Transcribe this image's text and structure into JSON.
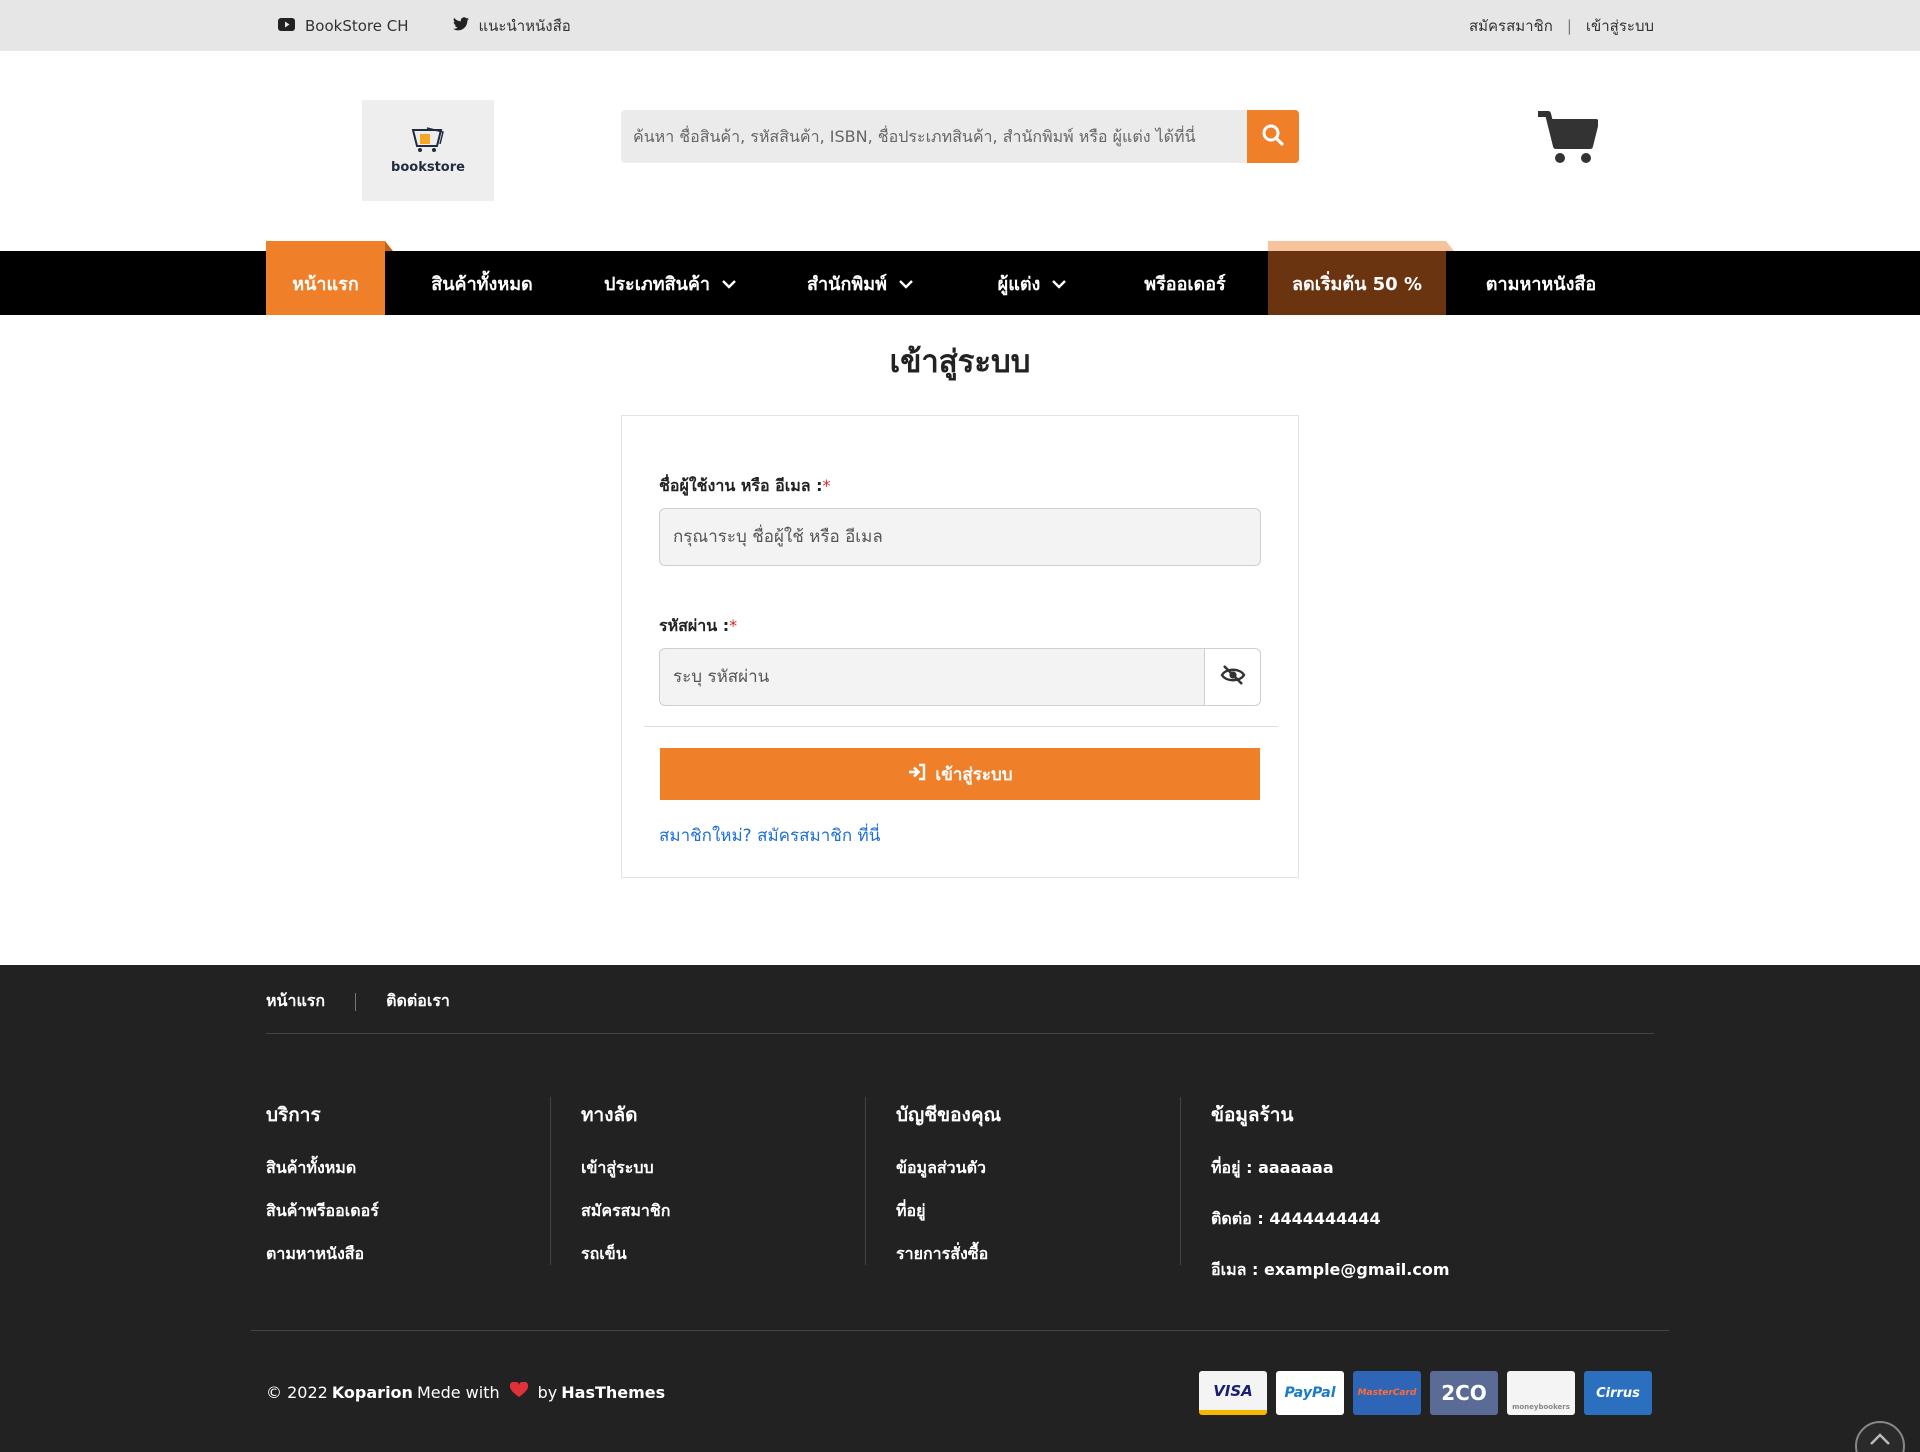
{
  "topbar": {
    "social": [
      {
        "icon": "youtube-icon",
        "label": "BookStore CH"
      },
      {
        "icon": "twitter-icon",
        "label": "แนะนำหนังสือ"
      }
    ],
    "register": "สมัครสมาชิก",
    "separator": "|",
    "login": "เข้าสู่ระบบ"
  },
  "header": {
    "logo_text": "bookstore",
    "search_placeholder": "ค้นหา ชื่อสินค้า, รหัสสินค้า, ISBN, ชื่อประเภทสินค้า, สำนักพิมพ์ หรือ ผู้แต่ง ได้ที่นี่",
    "accent_color": "#f07f2a"
  },
  "nav": {
    "items": [
      {
        "label": "หน้าแรก",
        "active": true
      },
      {
        "label": "สินค้าทั้งหมด"
      },
      {
        "label": "ประเภทสินค้า",
        "dropdown": true
      },
      {
        "label": "สำนักพิมพ์",
        "dropdown": true
      },
      {
        "label": "ผู้แต่ง",
        "dropdown": true
      },
      {
        "label": "พรีออเดอร์"
      },
      {
        "label": "ลดเริ่มต้น 50 %",
        "highlight": true
      },
      {
        "label": "ตามหาหนังสือ"
      }
    ]
  },
  "login": {
    "title": "เข้าสู่ระบบ",
    "username_label": "ชื่อผู้ใช้งาน หรือ อีเมล :",
    "username_placeholder": "กรุณาระบุ ชื่อผู้ใช้ หรือ อีเมล",
    "password_label": "รหัสผ่าน :",
    "password_placeholder": "ระบุ รหัสผ่าน",
    "required_mark": "*",
    "submit_label": "เข้าสู่ระบบ",
    "register_link": "สมาชิกใหม่? สมัครสมาชิก ที่นี่"
  },
  "footer": {
    "toplinks": [
      "หน้าแรก",
      "ติดต่อเรา"
    ],
    "columns": [
      {
        "title": "บริการ",
        "links": [
          "สินค้าทั้งหมด",
          "สินค้าพรีออเดอร์",
          "ตามหาหนังสือ"
        ]
      },
      {
        "title": "ทางลัด",
        "links": [
          "เข้าสู่ระบบ",
          "สมัครสมาชิก",
          "รถเข็น"
        ]
      },
      {
        "title": "บัญชีของคุณ",
        "links": [
          "ข้อมูลส่วนตัว",
          "ที่อยู่",
          "รายการสั่งซื้อ"
        ]
      }
    ],
    "store_info": {
      "title": "ข้อมูลร้าน",
      "address": "ที่อยู่ : aaaaaaa",
      "contact": "ติดต่อ : 4444444444",
      "email": "อีเมล : example@gmail.com"
    },
    "copyright_prefix": "© 2022",
    "copyright_brand": "Koparion",
    "copyright_made": "Mede with",
    "copyright_by": "by",
    "copyright_author": "HasThemes",
    "payments": [
      "VISA",
      "PayPal",
      "MasterCard",
      "2CO",
      "moneybookers",
      "Cirrus"
    ]
  }
}
